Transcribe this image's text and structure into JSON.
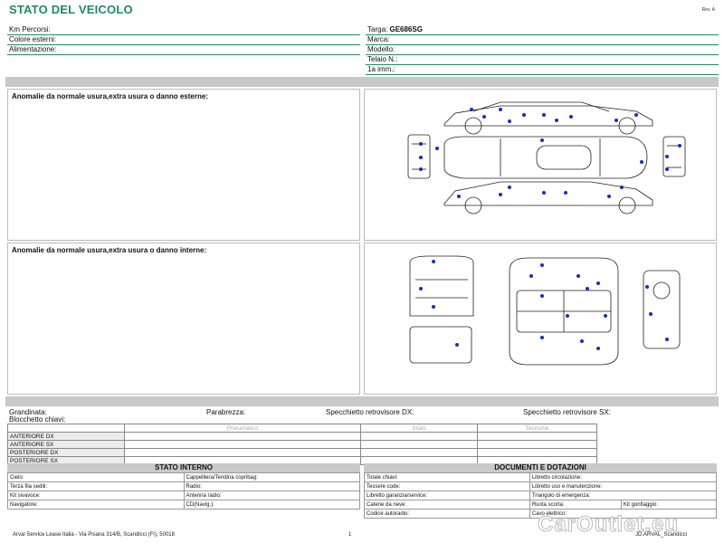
{
  "header": {
    "title": "STATO DEL VEICOLO",
    "revision": "Rev. A"
  },
  "vehicle_info": {
    "left": [
      {
        "label": "Km Percorsi:",
        "value": ""
      },
      {
        "label": "Colore esterni:",
        "value": ""
      },
      {
        "label": "Alimentazione:",
        "value": ""
      }
    ],
    "right": [
      {
        "label": "Targa:",
        "value": "GE686SG"
      },
      {
        "label": "Marca:",
        "value": ""
      },
      {
        "label": "Modello:",
        "value": ""
      },
      {
        "label": "Telaio N.:",
        "value": ""
      },
      {
        "label": "1a imm.:",
        "value": ""
      }
    ]
  },
  "panels": {
    "external_label": "Anomalie da normale usura,extra usura o danno esterne:",
    "internal_label": "Anomalie da normale usura,extra usura o danno interne:"
  },
  "checks": {
    "grandinata": "Grandinata:",
    "parabrezza": "Parabrezza:",
    "specchietto_dx": "Specchietto retrovisore DX:",
    "specchietto_sx": "Specchietto retrovisore SX:",
    "blocchetto": "Blocchetto chiavi:"
  },
  "tyres": {
    "headers": [
      "Pneumatico",
      "Stato",
      "Tecniche"
    ],
    "rows": [
      "ANTERIORE DX",
      "ANTERIORE SX",
      "POSTERIORE DX",
      "POSTERIORE SX"
    ]
  },
  "stato_interno": {
    "title": "STATO INTERNO",
    "rows": [
      [
        "Cielo:",
        "Cappelliera/Tendina copribag:"
      ],
      [
        "Terza fila sedili:",
        "Radio:"
      ],
      [
        "Kit sivavoce:",
        "Antenna radio:"
      ],
      [
        "Navigatore:",
        "CD(Navig.):"
      ]
    ]
  },
  "documenti": {
    "title": "DOCUMENTI E DOTAZIONI",
    "rows": [
      [
        "Totale chiavi:",
        "Libretto circolazione:",
        ""
      ],
      [
        "Tessere code:",
        "Libretto uso e manutenzione:",
        ""
      ],
      [
        "Libretto garanzia/service:",
        "Triangolo di emergenza:",
        ""
      ],
      [
        "Catene da neve:",
        "Ruota scorta:",
        "Kit gonfiaggio:"
      ],
      [
        "Codice autoradio:",
        "Cavo elettrico:",
        ""
      ]
    ]
  },
  "footer": {
    "address": "Arval Service Lease Italia - Via Pisana 314/B, Scandicci (FI), 50018",
    "page": "1",
    "right_text": "JD.ARVAL_Scandicci",
    "watermark": "CarOutlet.eu"
  },
  "colors": {
    "title_green": "#1f8a63",
    "gray_band": "#c8c8c8",
    "damage_dot": "#1b2fb0"
  }
}
